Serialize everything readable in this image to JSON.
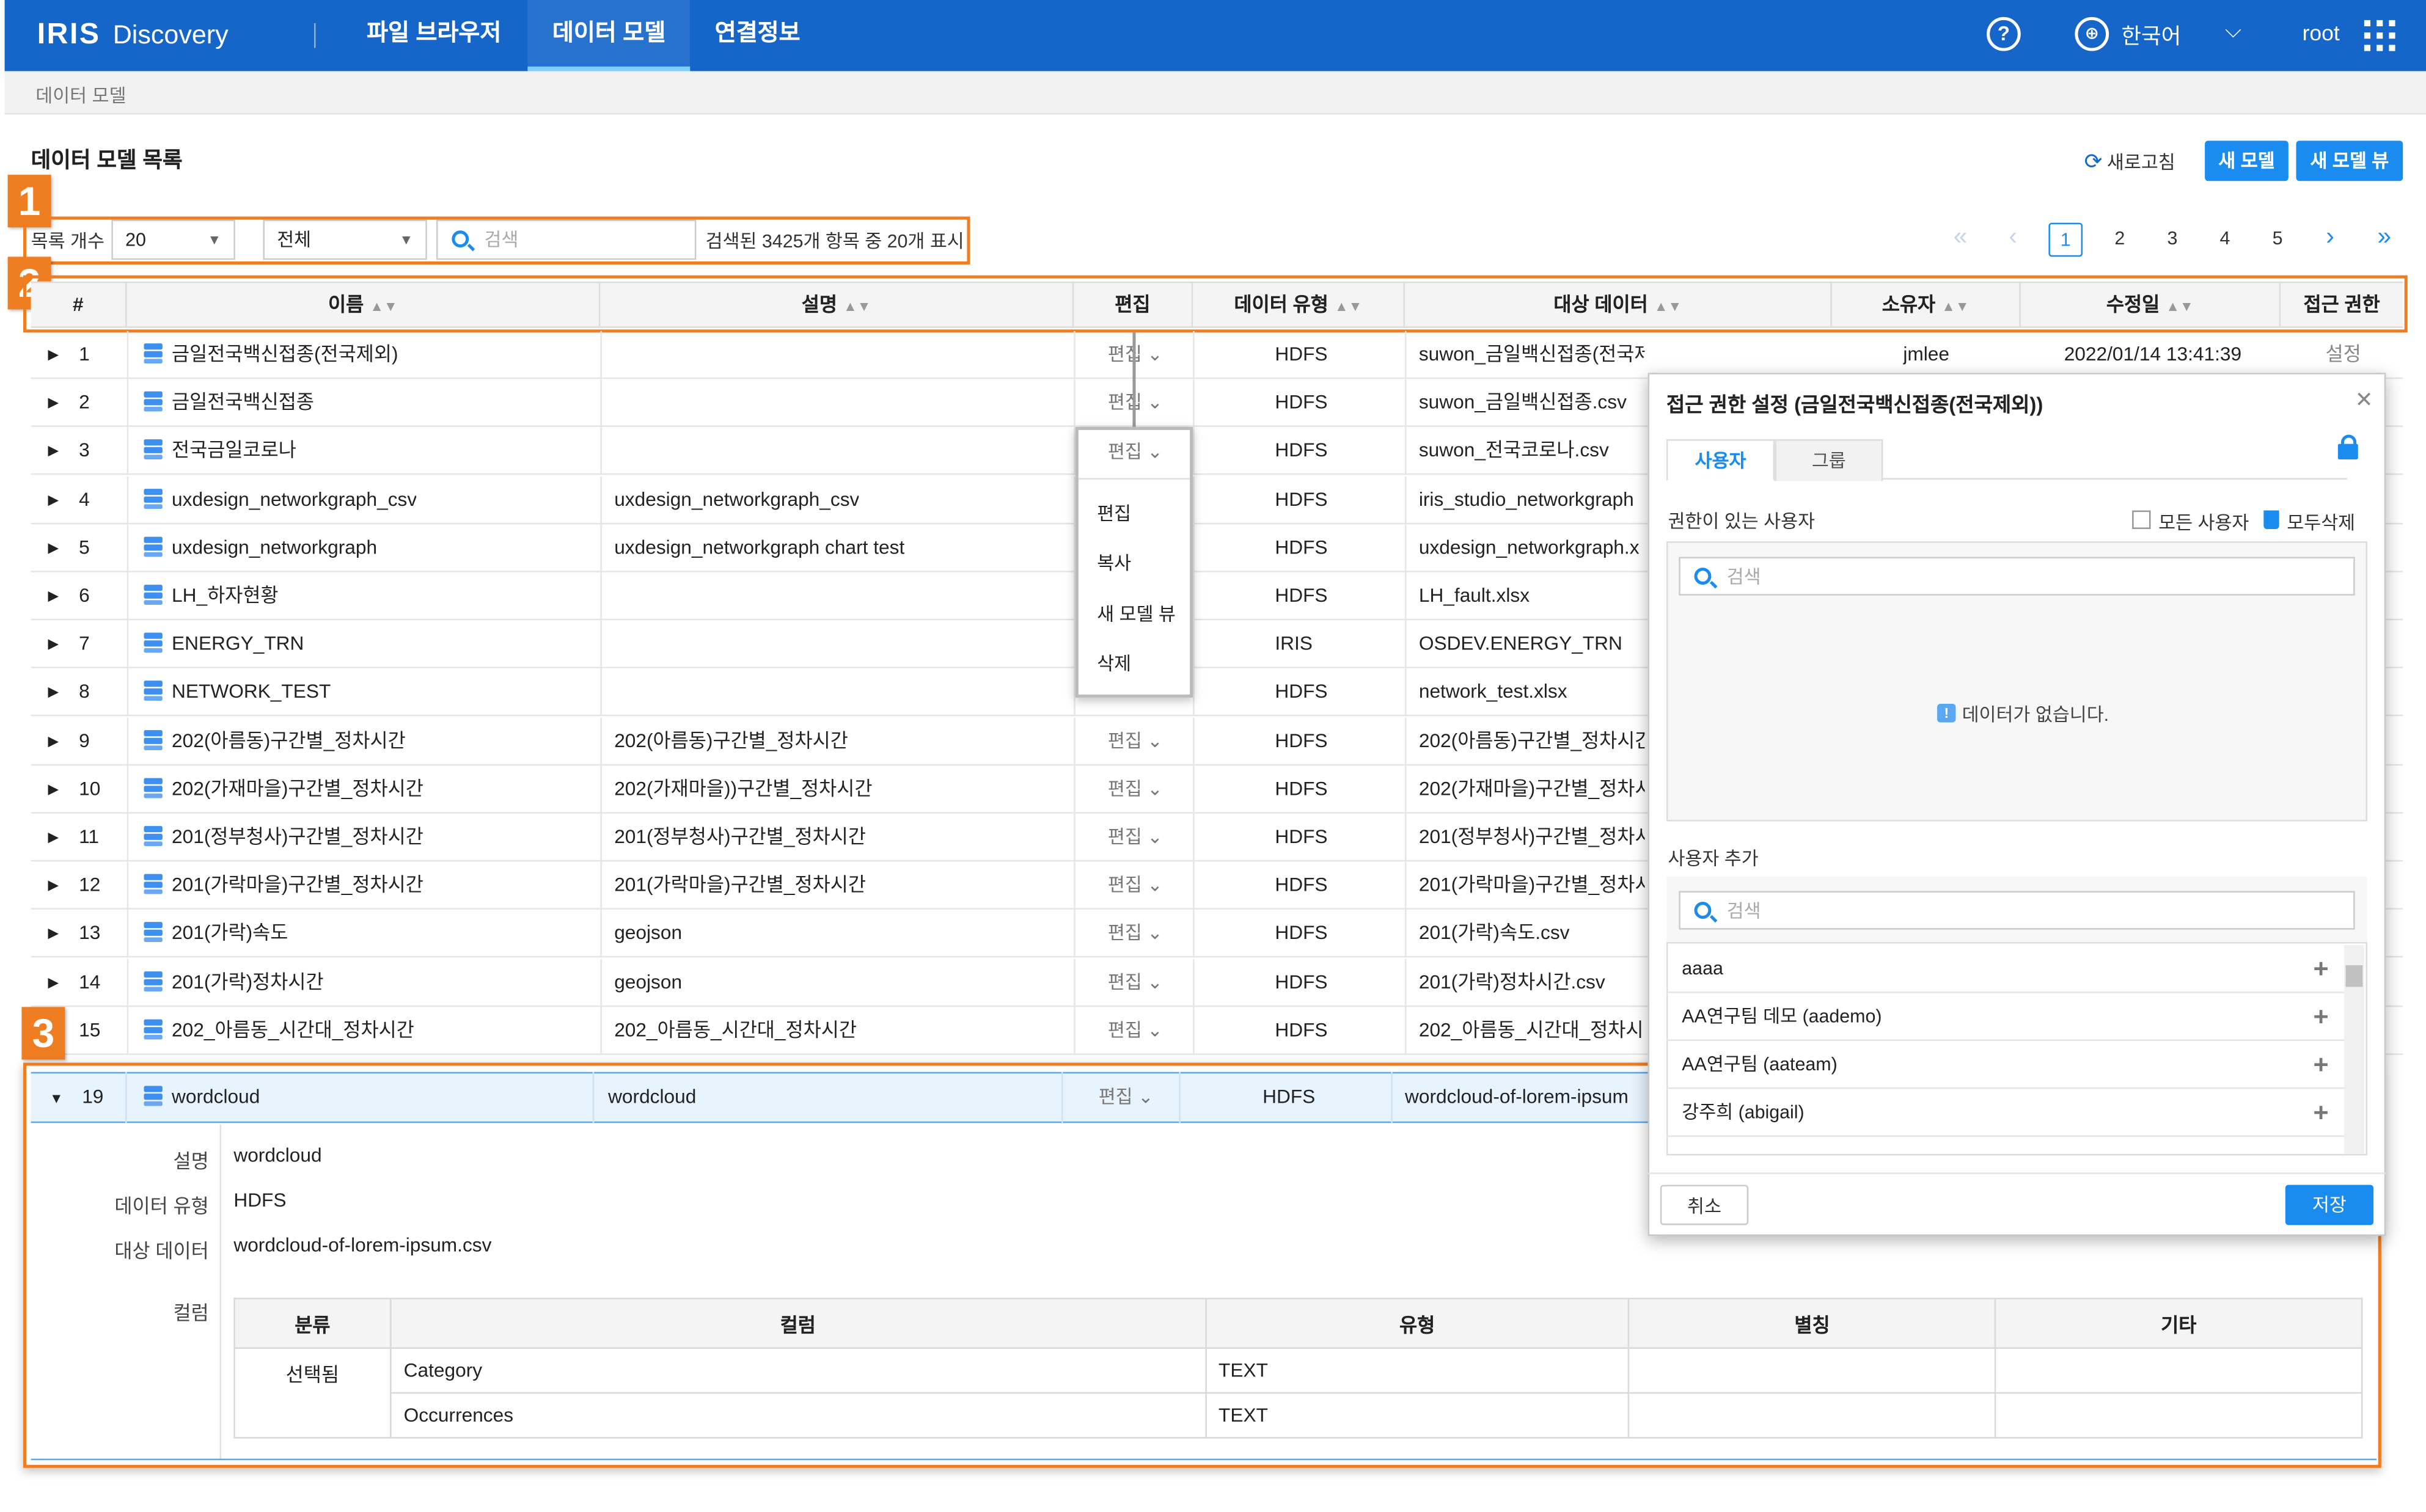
{
  "app": {
    "brand": "IRIS",
    "product": "Discovery",
    "user": "root",
    "language": "한국어"
  },
  "nav": [
    "파일 브라우저",
    "데이터 모델",
    "연결정보"
  ],
  "breadcrumb": "데이터 모델",
  "page": {
    "title": "데이터 모델 목록",
    "refresh": "새로고침",
    "new_model": "새 모델",
    "new_model_view": "새 모델 뷰"
  },
  "filter": {
    "count_label": "목록 개수",
    "count_value": "20",
    "scope": "전체",
    "search_placeholder": "검색",
    "result_text": "검색된 3425개 항목 중 20개 표시"
  },
  "pagination": {
    "pages": [
      "1",
      "2",
      "3",
      "4",
      "5"
    ],
    "current": "1"
  },
  "badges": [
    "1",
    "2",
    "3"
  ],
  "columns": [
    "#",
    "이름",
    "설명",
    "편집",
    "데이터 유형",
    "대상 데이터",
    "소유자",
    "수정일",
    "접근 권한"
  ],
  "rows": [
    {
      "n": "1",
      "name": "금일전국백신접종(전국제외)",
      "desc": "",
      "edit": "편집",
      "type": "HDFS",
      "target": "suwon_금일백신접종(전국제외).csv",
      "owner": "jmlee",
      "date": "2022/01/14 13:41:39",
      "access": "설정"
    },
    {
      "n": "2",
      "name": "금일전국백신접종",
      "desc": "",
      "edit": "편집",
      "type": "HDFS",
      "target": "suwon_금일백신접종.csv"
    },
    {
      "n": "3",
      "name": "전국금일코로나",
      "desc": "",
      "edit": "편집",
      "type": "HDFS",
      "target": "suwon_전국코로나.csv"
    },
    {
      "n": "4",
      "name": "uxdesign_networkgraph_csv",
      "desc": "uxdesign_networkgraph_csv",
      "edit": "",
      "type": "HDFS",
      "target": "iris_studio_networkgraph"
    },
    {
      "n": "5",
      "name": "uxdesign_networkgraph",
      "desc": "uxdesign_networkgraph chart test",
      "edit": "",
      "type": "HDFS",
      "target": "uxdesign_networkgraph.x"
    },
    {
      "n": "6",
      "name": "LH_하자현황",
      "desc": "",
      "edit": "",
      "type": "HDFS",
      "target": "LH_fault.xlsx"
    },
    {
      "n": "7",
      "name": "ENERGY_TRN",
      "desc": "",
      "edit": "",
      "type": "IRIS",
      "target": "OSDEV.ENERGY_TRN"
    },
    {
      "n": "8",
      "name": "NETWORK_TEST",
      "desc": "",
      "edit": "",
      "type": "HDFS",
      "target": "network_test.xlsx"
    },
    {
      "n": "9",
      "name": "202(아름동)구간별_정차시간",
      "desc": "202(아름동)구간별_정차시간",
      "edit": "편집",
      "type": "HDFS",
      "target": "202(아름동)구간별_정차시간"
    },
    {
      "n": "10",
      "name": "202(가재마을)구간별_정차시간",
      "desc": "202(가재마을))구간별_정차시간",
      "edit": "편집",
      "type": "HDFS",
      "target": "202(가재마을)구간별_정차시"
    },
    {
      "n": "11",
      "name": "201(정부청사)구간별_정차시간",
      "desc": "201(정부청사)구간별_정차시간",
      "edit": "편집",
      "type": "HDFS",
      "target": "201(정부청사)구간별_정차시"
    },
    {
      "n": "12",
      "name": "201(가락마을)구간별_정차시간",
      "desc": "201(가락마을)구간별_정차시간",
      "edit": "편집",
      "type": "HDFS",
      "target": "201(가락마을)구간별_정차시"
    },
    {
      "n": "13",
      "name": "201(가락)속도",
      "desc": "geojson",
      "edit": "편집",
      "type": "HDFS",
      "target": "201(가락)속도.csv"
    },
    {
      "n": "14",
      "name": "201(가락)정차시간",
      "desc": "geojson",
      "edit": "편집",
      "type": "HDFS",
      "target": "201(가락)정차시간.csv"
    },
    {
      "n": "15",
      "name": "202_아름동_시간대_정차시간",
      "desc": "202_아름동_시간대_정차시간",
      "edit": "편집",
      "type": "HDFS",
      "target": "202_아름동_시간대_정차시긴"
    }
  ],
  "menu": {
    "header": "편집",
    "items": [
      "편집",
      "복사",
      "새 모델 뷰",
      "삭제"
    ]
  },
  "dialog": {
    "title": "접근 권한 설정 (금일전국백신접종(전국제외))",
    "tabs": [
      "사용자",
      "그룹"
    ],
    "with_permission": "권한이 있는 사용자",
    "all_users": "모든 사용자",
    "delete_all": "모두삭제",
    "search_placeholder": "검색",
    "empty": "데이터가 없습니다.",
    "add_user": "사용자 추가",
    "users": [
      "aaaa",
      "AA연구팀 데모 (aademo)",
      "AA연구팀 (aateam)",
      "강주희 (abigail)"
    ],
    "cancel": "취소",
    "save": "저장"
  },
  "expanded": {
    "n": "19",
    "name": "wordcloud",
    "desc": "wordcloud",
    "edit": "편집",
    "type": "HDFS",
    "target": "wordcloud-of-lorem-ipsum",
    "labels": {
      "desc": "설명",
      "type": "데이터 유형",
      "target": "대상 데이터",
      "columns": "컬럼"
    },
    "values": {
      "desc": "wordcloud",
      "type": "HDFS",
      "target": "wordcloud-of-lorem-ipsum.csv"
    },
    "col_headers": [
      "분류",
      "컬럼",
      "유형",
      "별칭",
      "기타"
    ],
    "col_rows": [
      {
        "cls": "선택됨",
        "col": "Category",
        "type": "TEXT"
      },
      {
        "cls": "",
        "col": "Occurrences",
        "type": "TEXT"
      }
    ]
  },
  "colors": {
    "primary": "#1566c8",
    "button": "#1a8cf0",
    "highlight": "#ef7d22"
  }
}
